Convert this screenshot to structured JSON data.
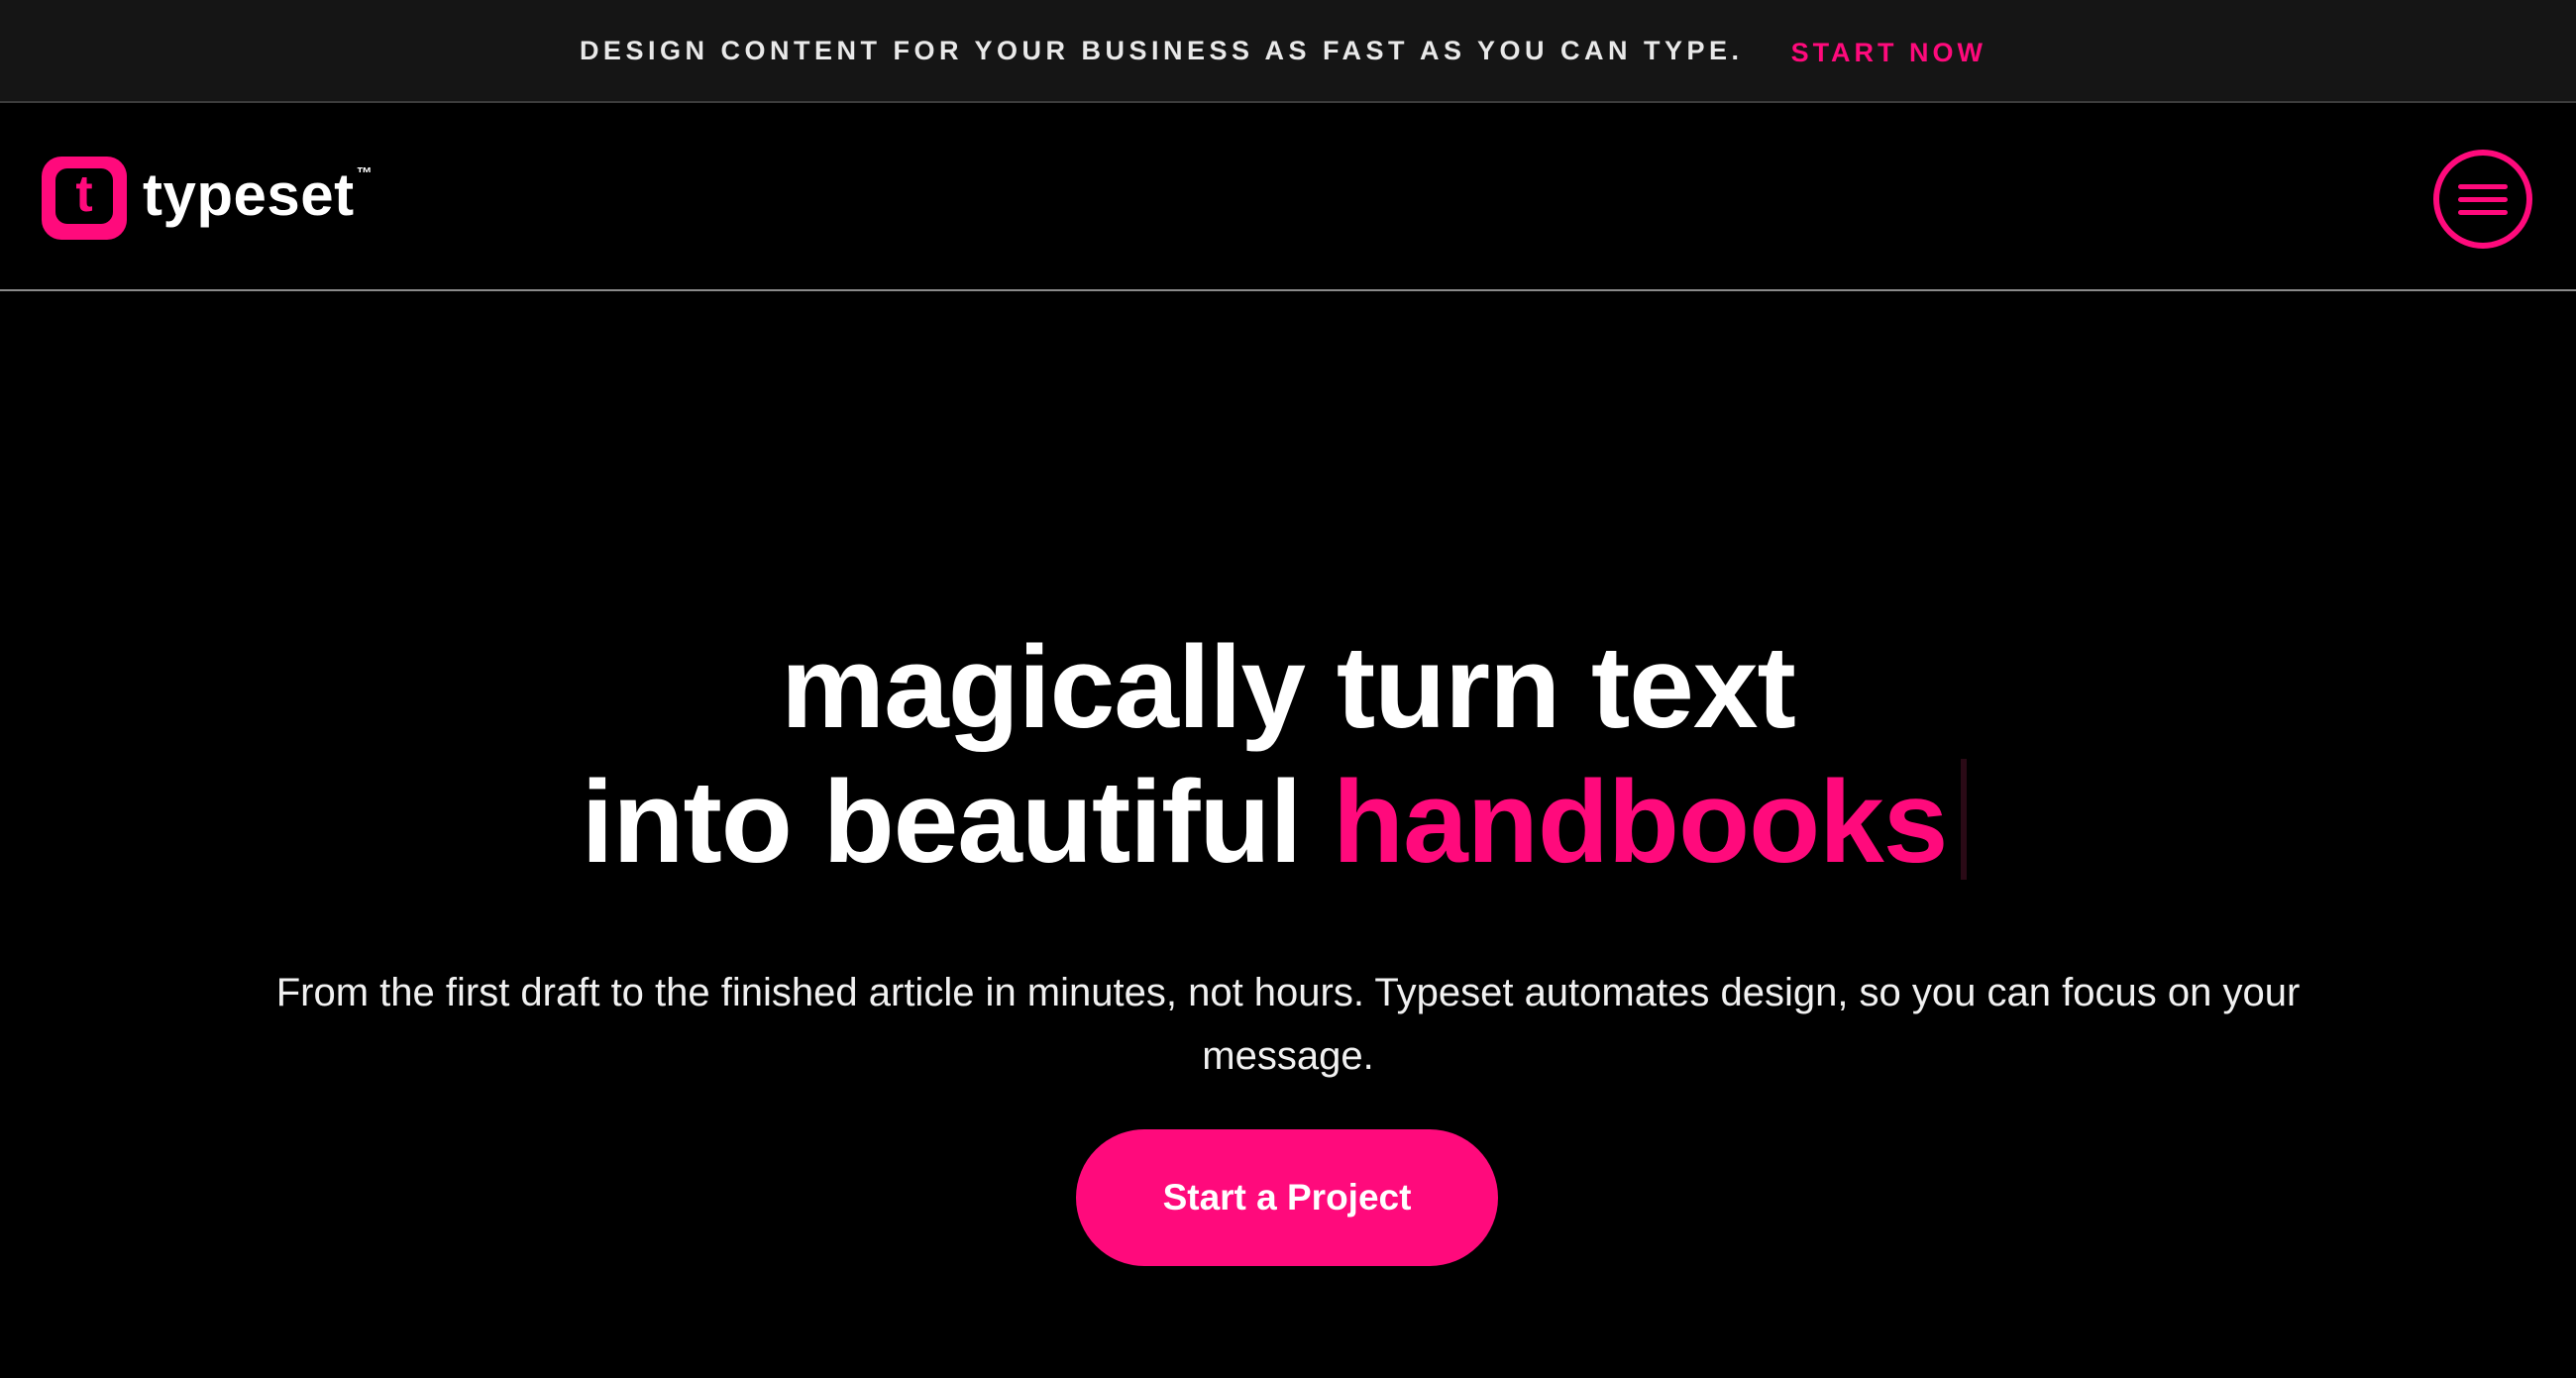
{
  "announcement": {
    "text": "DESIGN CONTENT FOR YOUR BUSINESS AS FAST AS YOU CAN TYPE.",
    "link_label": "START NOW"
  },
  "nav": {
    "logo_letter": "t",
    "brand_name": "typeset",
    "trademark": "™",
    "menu_icon": "hamburger-icon"
  },
  "hero": {
    "headline_line1": "magically turn text",
    "headline_line2_prefix": "into beautiful",
    "headline_highlight": "handbooks",
    "subheading": "From the first draft to the finished article in minutes, not hours.  Typeset automates design, so you can focus on your message.",
    "cta_label": "Start a Project"
  },
  "colors": {
    "background": "#000000",
    "announcement_bg": "#151515",
    "accent": "#ff0a7c",
    "text": "#ffffff"
  }
}
